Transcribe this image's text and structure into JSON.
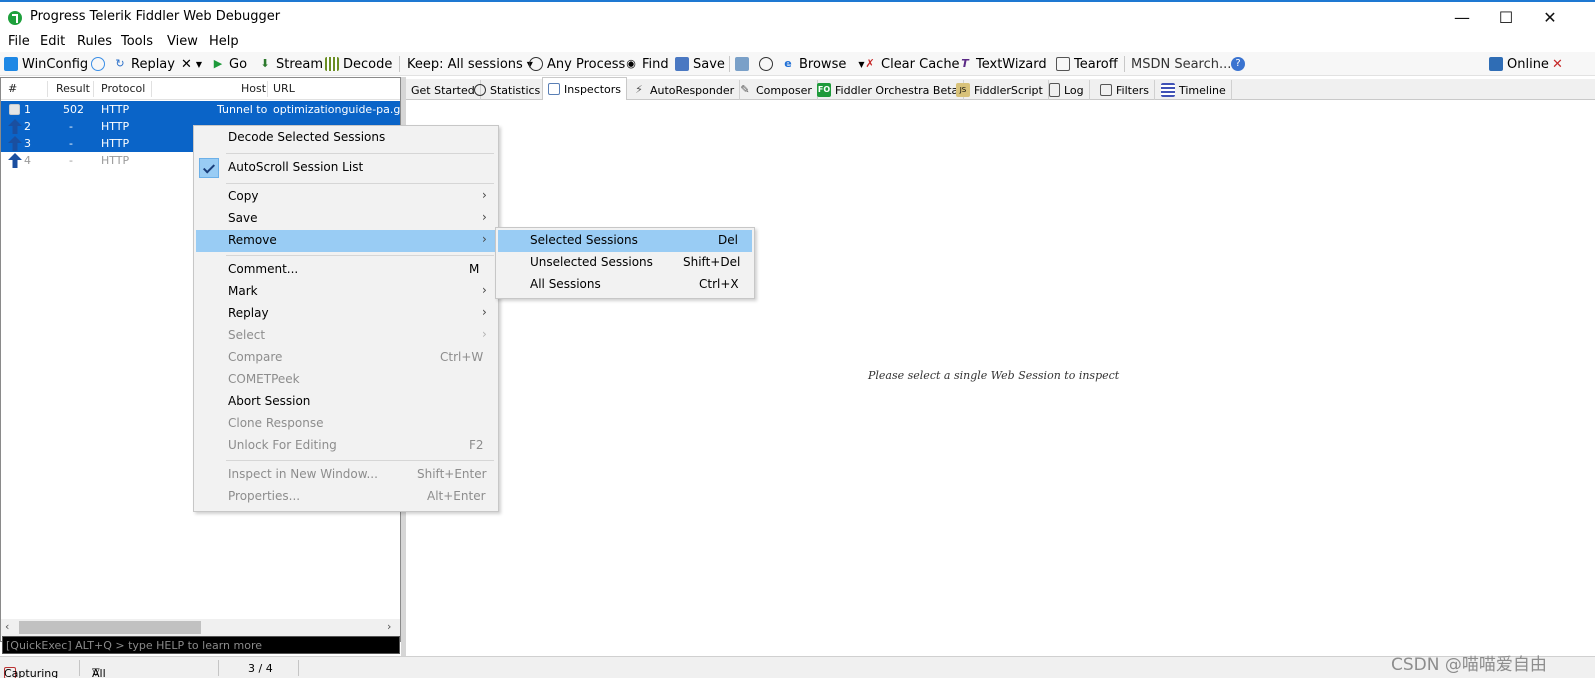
{
  "window": {
    "title": "Progress Telerik Fiddler Web Debugger"
  },
  "menubar": [
    "File",
    "Edit",
    "Rules",
    "Tools",
    "View",
    "Help"
  ],
  "toolbar": {
    "winconfig": "WinConfig",
    "replay": "Replay",
    "remove": "✕",
    "go": "Go",
    "stream": "Stream",
    "decode": "Decode",
    "keep": "Keep: All sessions",
    "any_process": "Any Process",
    "find": "Find",
    "save": "Save",
    "browse": "Browse",
    "clear_cache": "Clear Cache",
    "textwizard": "TextWizard",
    "tearoff": "Tearoff",
    "msdn": "MSDN Search...",
    "online": "Online"
  },
  "sessions": {
    "columns": [
      "#",
      "Result",
      "Protocol",
      "Host",
      "URL"
    ],
    "rows": [
      {
        "id": "1",
        "result": "502",
        "protocol": "HTTP",
        "host": "Tunnel to",
        "url": "optimizationguide-pa.goo"
      },
      {
        "id": "2",
        "result": "-",
        "protocol": "HTTP",
        "host": "",
        "url": ""
      },
      {
        "id": "3",
        "result": "-",
        "protocol": "HTTP",
        "host": "",
        "url": ""
      },
      {
        "id": "4",
        "result": "-",
        "protocol": "HTTP",
        "host": "",
        "url": ""
      }
    ]
  },
  "quickexec": "[QuickExec] ALT+Q > type HELP to learn more",
  "tabs": [
    "Get Started",
    "Statistics",
    "Inspectors",
    "AutoResponder",
    "Composer",
    "Fiddler Orchestra Beta",
    "FiddlerScript",
    "Log",
    "Filters",
    "Timeline"
  ],
  "inspector_message": "Please select a single Web Session to inspect",
  "context_menu": {
    "decode_selected": "Decode Selected Sessions",
    "autoscroll": "AutoScroll Session List",
    "copy": "Copy",
    "save": "Save",
    "remove": "Remove",
    "comment": "Comment...",
    "comment_sc": "M",
    "mark": "Mark",
    "replay": "Replay",
    "select": "Select",
    "compare": "Compare",
    "compare_sc": "Ctrl+W",
    "cometpeek": "COMETPeek",
    "abort": "Abort Session",
    "clone": "Clone Response",
    "unlock": "Unlock For Editing",
    "unlock_sc": "F2",
    "inspect_new": "Inspect in New Window...",
    "inspect_new_sc": "Shift+Enter",
    "properties": "Properties...",
    "properties_sc": "Alt+Enter"
  },
  "remove_submenu": {
    "selected": "Selected Sessions",
    "selected_sc": "Del",
    "unselected": "Unselected Sessions",
    "unselected_sc": "Shift+Del",
    "all": "All Sessions",
    "all_sc": "Ctrl+X"
  },
  "statusbar": {
    "capturing": "Capturing",
    "processes": "All Processes",
    "count": "3 / 4"
  },
  "watermark": "CSDN @喵喵爱自由",
  "colors": {
    "selection": "#0a64c8",
    "menu_highlight": "#99ccf4",
    "title_accent": "#1e78d2"
  }
}
